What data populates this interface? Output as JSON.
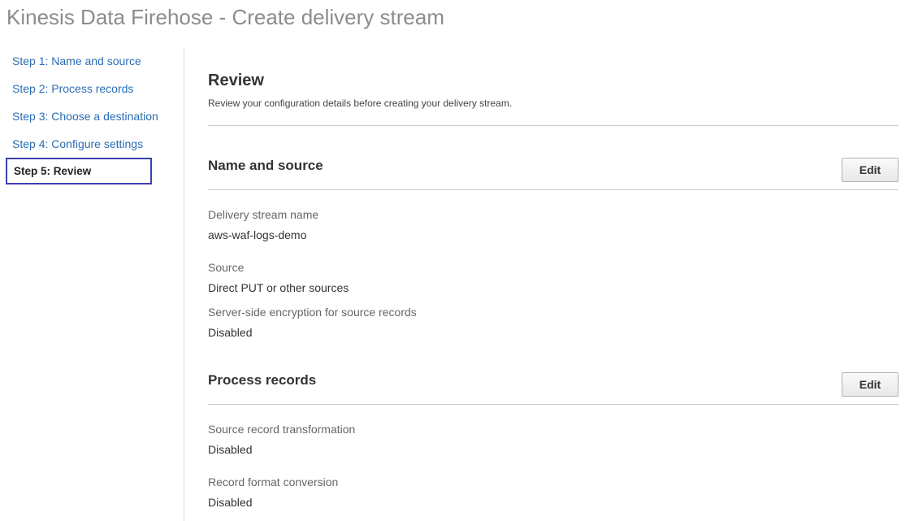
{
  "page": {
    "title": "Kinesis Data Firehose - Create delivery stream"
  },
  "sidebar": {
    "steps": [
      {
        "label": "Step 1: Name and source",
        "active": false
      },
      {
        "label": "Step 2: Process records",
        "active": false
      },
      {
        "label": "Step 3: Choose a destination",
        "active": false
      },
      {
        "label": "Step 4: Configure settings",
        "active": false
      },
      {
        "label": "Step 5: Review",
        "active": true
      }
    ]
  },
  "review": {
    "title": "Review",
    "subtitle": "Review your configuration details before creating your delivery stream."
  },
  "sections": [
    {
      "title": "Name and source",
      "edit_label": "Edit",
      "fields": [
        {
          "label": "Delivery stream name",
          "value": "aws-waf-logs-demo"
        },
        {
          "label": "Source",
          "value": "Direct PUT or other sources"
        },
        {
          "label": "Server-side encryption for source records",
          "value": "Disabled"
        }
      ]
    },
    {
      "title": "Process records",
      "edit_label": "Edit",
      "fields": [
        {
          "label": "Source record transformation",
          "value": "Disabled"
        },
        {
          "label": "Record format conversion",
          "value": "Disabled"
        }
      ]
    }
  ],
  "colors": {
    "link": "#2a6db5",
    "active_step_border": "#3b3fb0",
    "title_gray": "#8c8c8c"
  }
}
